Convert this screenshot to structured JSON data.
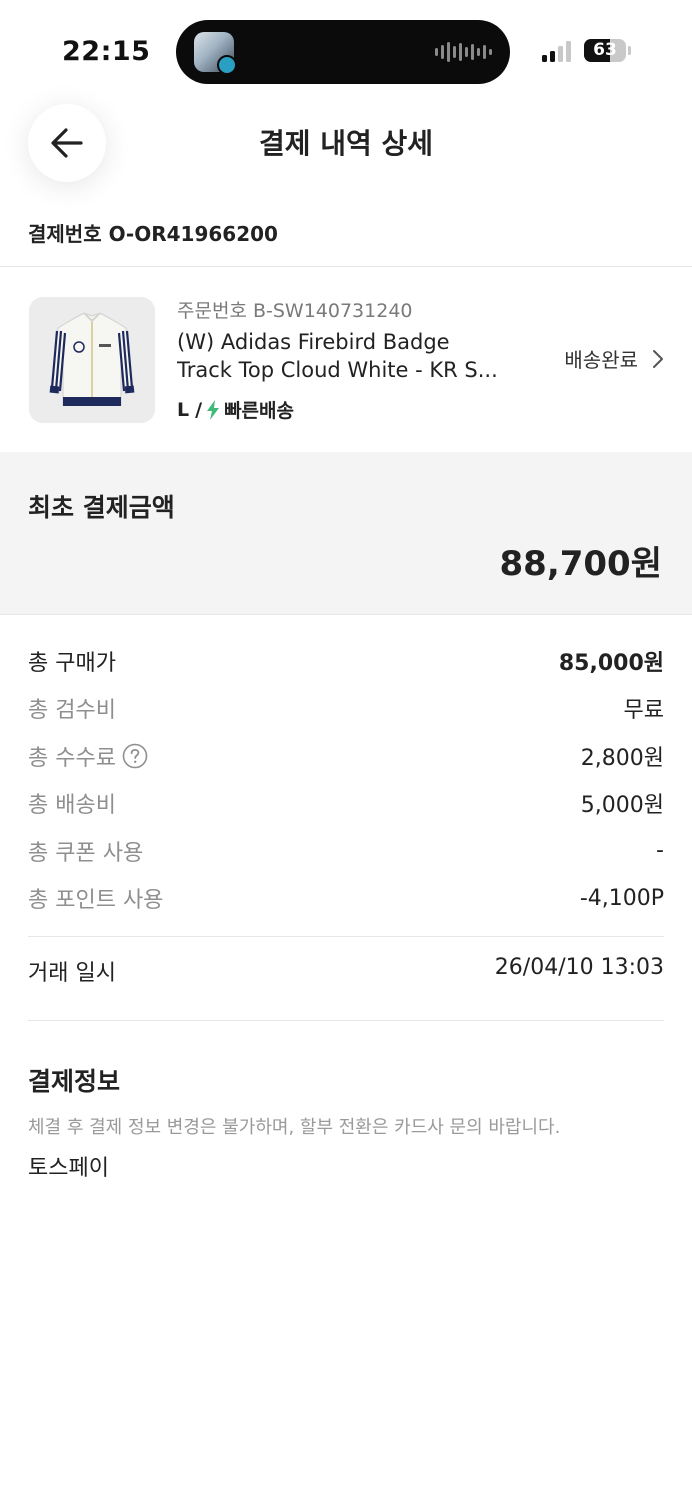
{
  "status_bar": {
    "time": "22:15",
    "battery": "63",
    "battery_level": 0.63
  },
  "header": {
    "title": "결제 내역 상세"
  },
  "payment": {
    "label": "결제번호",
    "number": "O-OR41966200",
    "display": "결제번호 O-OR41966200"
  },
  "product": {
    "order_number": "주문번호 B-SW140731240",
    "name_line1": "(W) Adidas Firebird Badge",
    "name_line2": "Track Top Cloud White - KR S...",
    "size": "L",
    "separator": "/",
    "delivery_type": "빠른배송",
    "status": "배송완료",
    "accent_color": "#41b979"
  },
  "initial_payment": {
    "label": "최초 결제금액",
    "amount": "88,700원"
  },
  "breakdown": [
    {
      "label": "총 구매가",
      "value": "85,000원"
    },
    {
      "label": "총 검수비",
      "value": "무료"
    },
    {
      "label": "총 수수료",
      "value": "2,800원"
    },
    {
      "label": "총 배송비",
      "value": "5,000원"
    },
    {
      "label": "총 쿠폰 사용",
      "value": "-"
    },
    {
      "label": "총 포인트 사용",
      "value": "-4,100P"
    }
  ],
  "trade": {
    "label": "거래 일시",
    "value": "26/04/10 13:03"
  },
  "payment_info": {
    "title": "결제정보",
    "note": "체결 후 결제 정보 변경은 불가하며, 할부 전환은 카드사 문의 바랍니다.",
    "method": "토스페이"
  }
}
